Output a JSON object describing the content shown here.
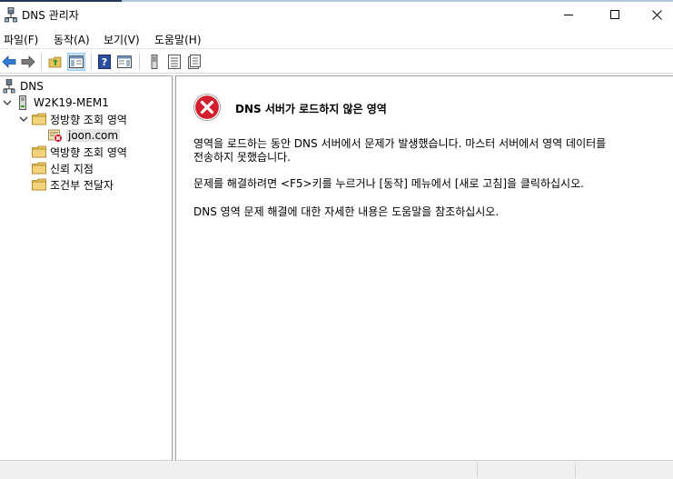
{
  "window": {
    "title": "DNS 관리자"
  },
  "menu": {
    "file": "파일(F)",
    "action": "동작(A)",
    "view": "보기(V)",
    "help": "도움말(H)"
  },
  "tree": {
    "root": "DNS",
    "server": "W2K19-MEM1",
    "forward_zones": "정방향 조회 영역",
    "zone": "joon.com",
    "reverse_zones": "역방향 조회 영역",
    "trust_points": "신뢰 지점",
    "conditional_forwarders": "조건부 전달자"
  },
  "content": {
    "error_title": "DNS 서버가 로드하지 않은 영역",
    "message_1_line1": "영역을 로드하는 동안 DNS 서버에서 문제가 발생했습니다. 마스터 서버에서 영역 데이터를",
    "message_1_line2": "전송하지 못했습니다.",
    "message_2": "문제를 해결하려면 <F5>키를 누르거나 [동작] 메뉴에서 [새로 고침]을 클릭하십시오.",
    "message_3": "DNS 영역 문제 해결에 대한 자세한 내용은 도움말을 참조하십시오."
  },
  "colors": {
    "error_red": "#d3202f",
    "folder_yellow": "#e8c25a",
    "selection_gray": "#e5e5e5",
    "pressed_blue": "#cce4f7"
  },
  "icons": {
    "title": "dns-manager-icon",
    "back": "back-arrow-icon",
    "forward": "forward-arrow-icon",
    "up": "up-folder-icon",
    "show_hide_tree": "show-hide-tree-icon",
    "help": "help-icon",
    "show_hide_action": "show-hide-action-pane-icon",
    "server_action1": "server-list-icon",
    "server_action2": "list-icon",
    "server_action3": "properties-icon"
  }
}
